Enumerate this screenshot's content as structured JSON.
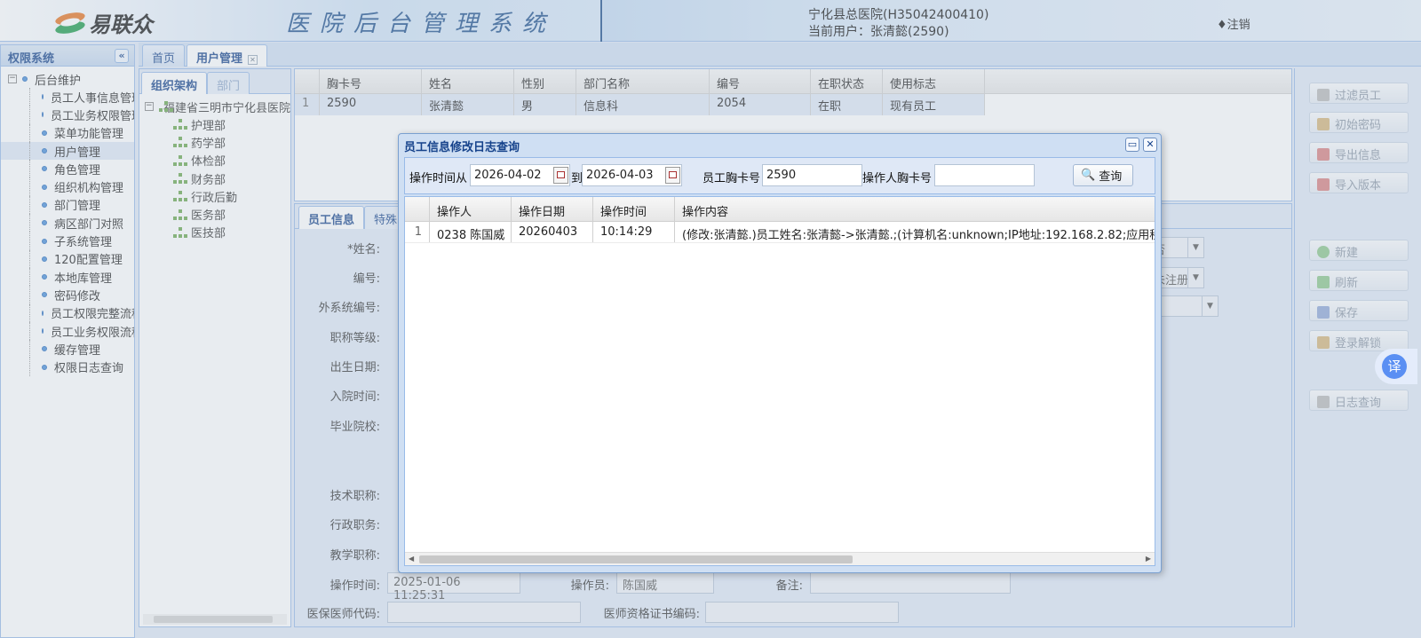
{
  "header": {
    "logo_text": "易联众",
    "system_title": "医院后台管理系统",
    "hospital": "宁化县总医院(H35042400410)",
    "current_user": "当前用户：张清懿(2590)",
    "logout": "♦注销"
  },
  "sidebar": {
    "title": "权限系统",
    "collapse": "«",
    "root": "后台维护",
    "items": [
      {
        "label": "员工人事信息管理"
      },
      {
        "label": "员工业务权限管理"
      },
      {
        "label": "菜单功能管理"
      },
      {
        "label": "用户管理"
      },
      {
        "label": "角色管理"
      },
      {
        "label": "组织机构管理"
      },
      {
        "label": "部门管理"
      },
      {
        "label": "病区部门对照"
      },
      {
        "label": "子系统管理"
      },
      {
        "label": "120配置管理"
      },
      {
        "label": "本地库管理"
      },
      {
        "label": "密码修改"
      },
      {
        "label": "员工权限完整流程"
      },
      {
        "label": "员工业务权限流程"
      },
      {
        "label": "缓存管理"
      },
      {
        "label": "权限日志查询"
      }
    ]
  },
  "tabs": [
    {
      "label": "首页"
    },
    {
      "label": "用户管理"
    }
  ],
  "org_panel": {
    "tabs": [
      "组织架构",
      "部门"
    ],
    "root": "福建省三明市宁化县医院",
    "depts": [
      "护理部",
      "药学部",
      "体检部",
      "财务部",
      "行政后勤",
      "医务部",
      "医技部"
    ]
  },
  "main_grid": {
    "headers": [
      "胸卡号",
      "姓名",
      "性别",
      "部门名称",
      "编号",
      "在职状态",
      "使用标志"
    ],
    "rows": [
      {
        "no": "1",
        "card": "2590",
        "name": "张清懿",
        "sex": "男",
        "dept": "信息科",
        "code": "2054",
        "status": "在职",
        "flag": "现有员工"
      }
    ]
  },
  "right_buttons": {
    "filter_staff": "过滤员工",
    "init_pwd": "初始密码",
    "export": "导出信息",
    "import": "导入版本",
    "new": "新建",
    "refresh": "刷新",
    "save": "保存",
    "login_unlock": "登录解锁",
    "log_query": "日志查询"
  },
  "form": {
    "tabs": [
      "员工信息",
      "特殊"
    ],
    "labels": {
      "name": "*姓名:",
      "code": "编号:",
      "ext_code": "外系统编号:",
      "title_level": "职称等级:",
      "birth": "出生日期:",
      "hire": "入院时间:",
      "school": "毕业院校:",
      "tech_title": "技术职称:",
      "admin_post": "行政职务:",
      "teach_title": "教学职称:",
      "op_time": "操作时间:",
      "operator": "操作员:",
      "remark": "备注:",
      "insur_code": "医保医师代码:",
      "cert_code": "医师资格证书编码:"
    },
    "op_time_value": "2025-01-06 11:25:31",
    "operator_value": "陈国威",
    "sel_no": "否",
    "sel_unreg": "未注册"
  },
  "modal": {
    "title": "员工信息修改日志查询",
    "from_label": "操作时间从",
    "from_date": "2026-04-02",
    "to_label": "到",
    "to_date": "2026-04-03",
    "card_label": "员工胸卡号",
    "card_value": "2590",
    "op_card_label": "操作人胸卡号",
    "op_card_value": "",
    "query_label": "查询",
    "headers": [
      "操作人",
      "操作日期",
      "操作时间",
      "操作内容"
    ],
    "rows": [
      {
        "no": "1",
        "operator": "0238 陈国威",
        "date": "20260403",
        "time": "10:14:29",
        "content": "(修改:张清懿.)员工姓名:张清懿->张清懿.;(计算机名:unknown;IP地址:192.168.2.82;应用程序:JD"
      }
    ]
  },
  "translate_label": "译"
}
